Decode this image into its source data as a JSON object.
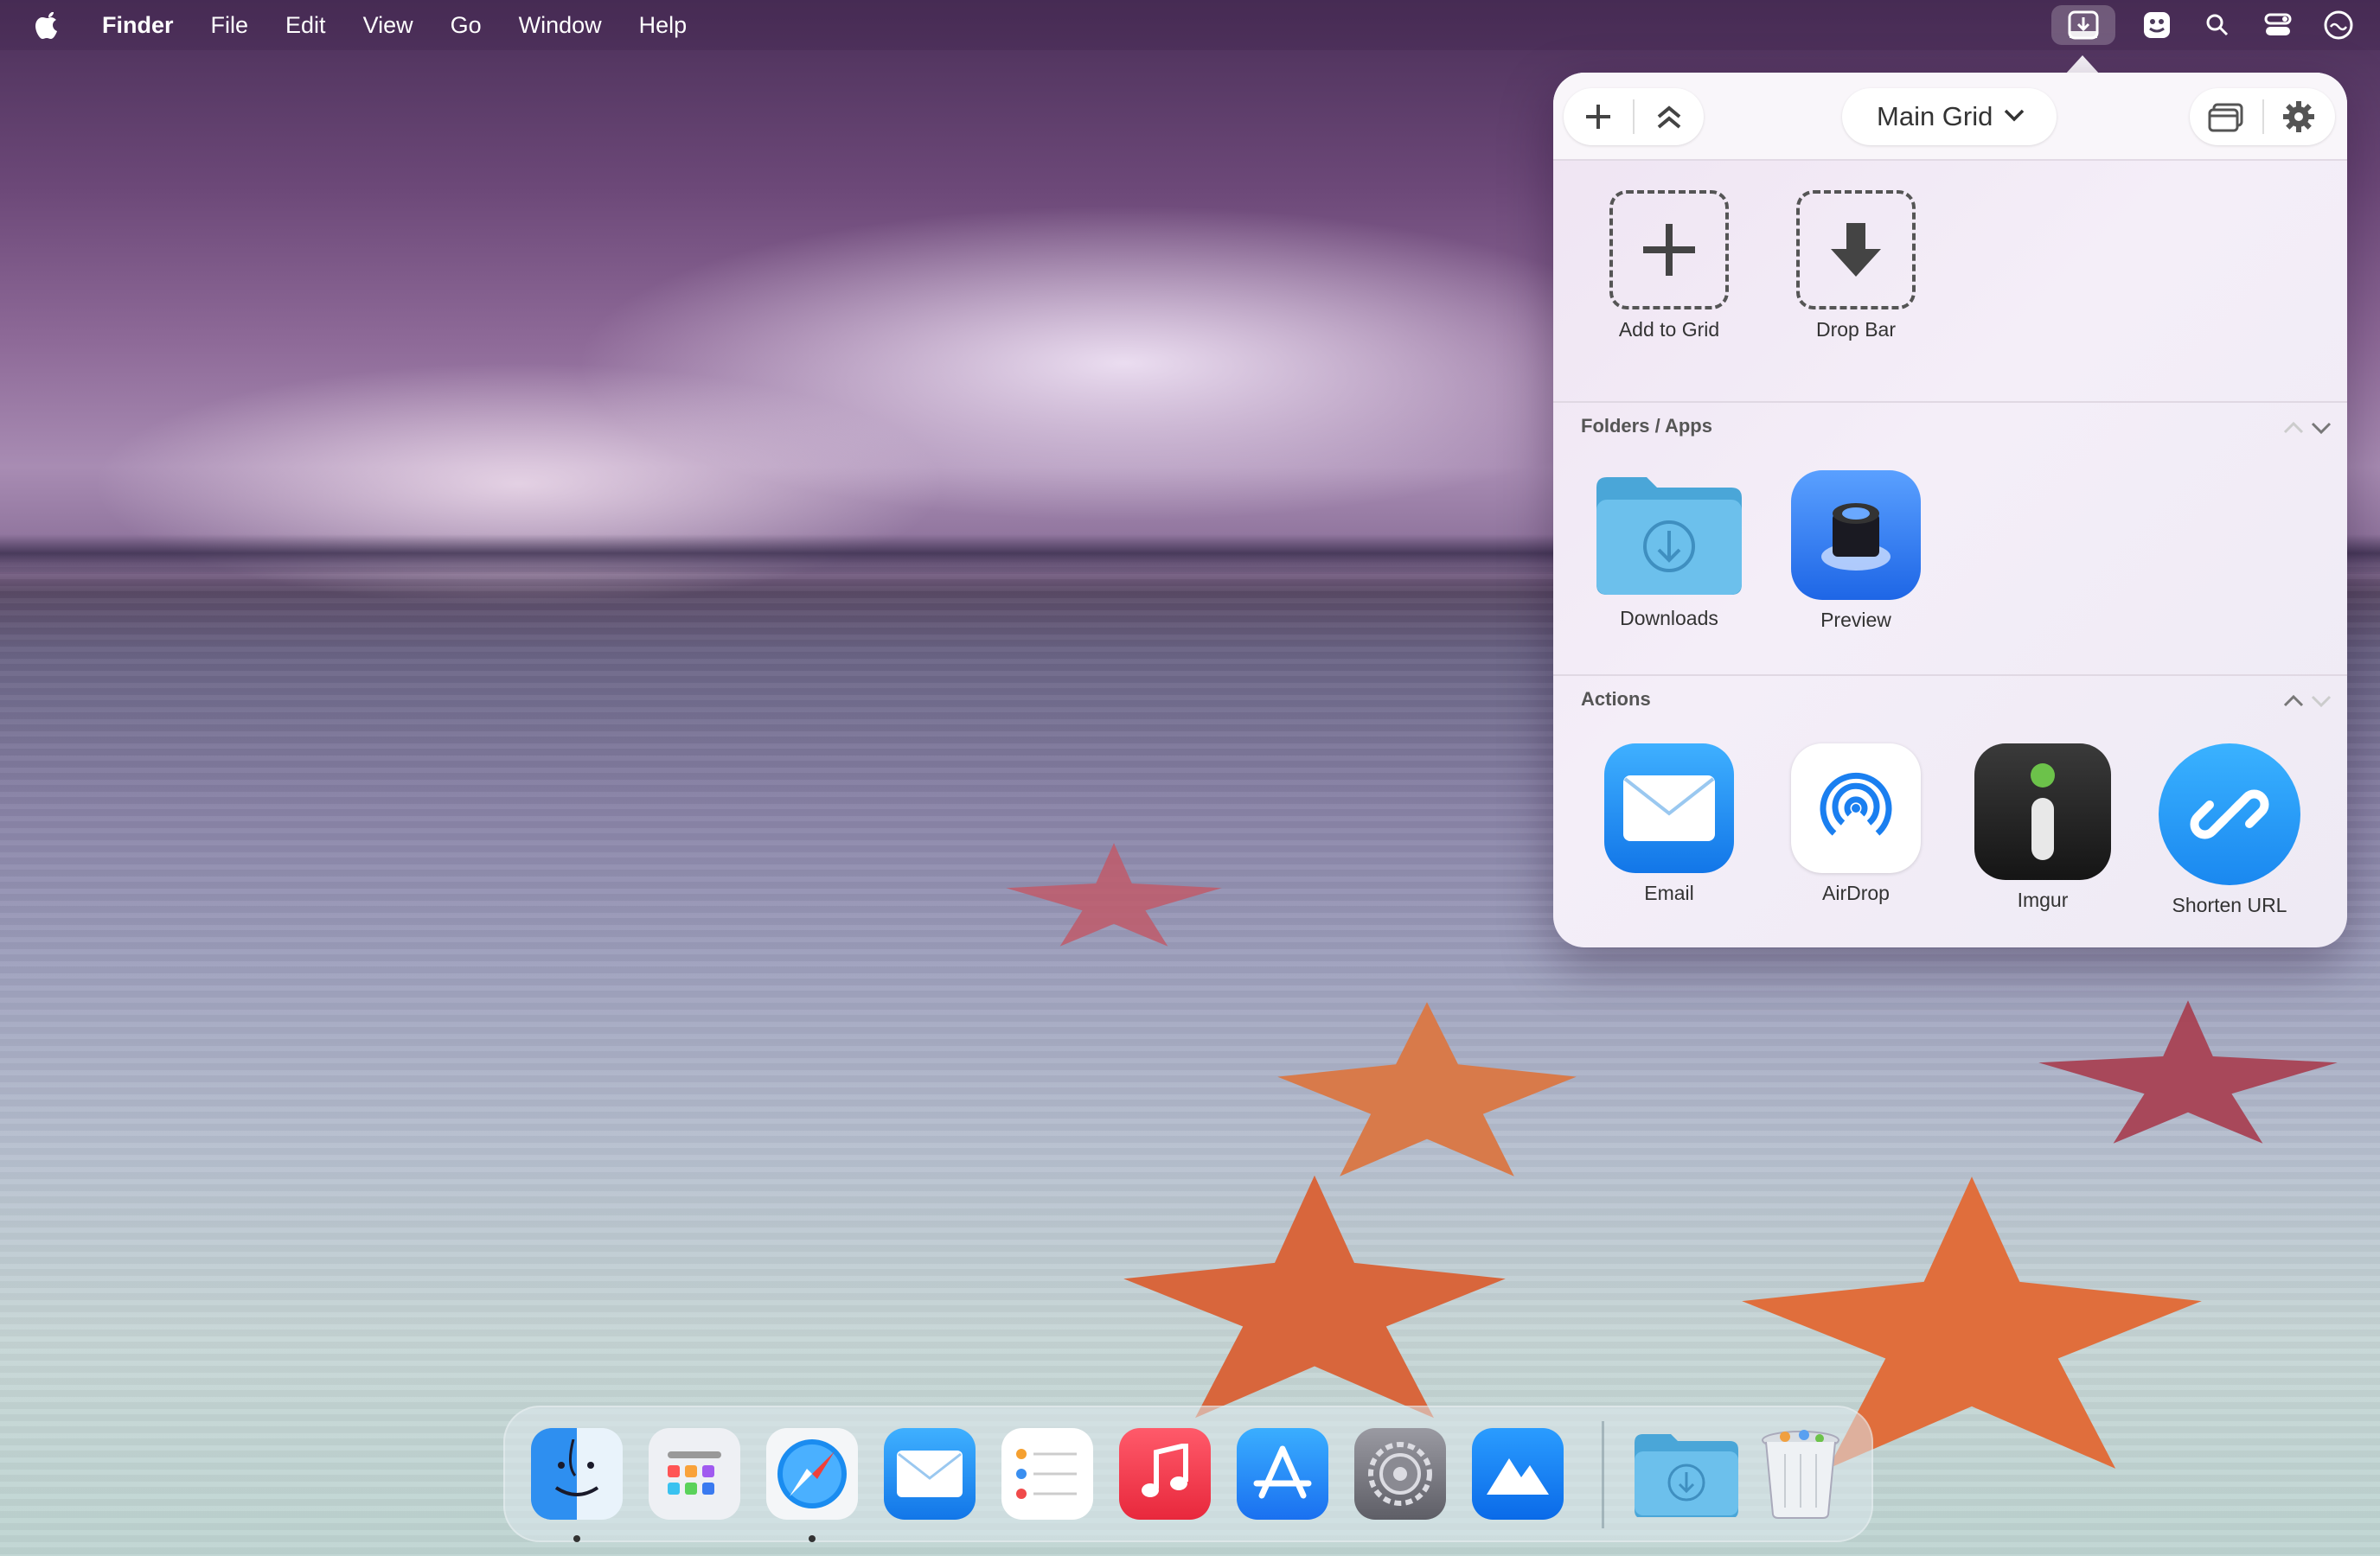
{
  "menubar": {
    "app_name": "Finder",
    "items": [
      "File",
      "Edit",
      "View",
      "Go",
      "Window",
      "Help"
    ],
    "status_icons": [
      "dropzone-icon",
      "tray-icon",
      "search-icon",
      "control-center-icon",
      "siri-icon"
    ]
  },
  "panel": {
    "grid_selector": "Main Grid",
    "toolbar_icons": [
      "plus-icon",
      "collapse-all-icon",
      "windows-icon",
      "gear-icon"
    ],
    "top_tiles": [
      {
        "label": "Add to Grid",
        "icon": "add-icon"
      },
      {
        "label": "Drop Bar",
        "icon": "download-arrow-icon"
      }
    ],
    "folders_section": {
      "title": "Folders / Apps",
      "items": [
        {
          "label": "Downloads",
          "icon": "downloads-folder-icon"
        },
        {
          "label": "Preview",
          "icon": "preview-app-icon"
        }
      ]
    },
    "actions_section": {
      "title": "Actions",
      "items": [
        {
          "label": "Email",
          "icon": "mail-icon"
        },
        {
          "label": "AirDrop",
          "icon": "airdrop-icon"
        },
        {
          "label": "Imgur",
          "icon": "imgur-icon"
        },
        {
          "label": "Shorten URL",
          "icon": "link-icon"
        }
      ]
    }
  },
  "dock": {
    "apps": [
      "finder-icon",
      "launchpad-icon",
      "safari-icon",
      "mail-icon",
      "reminders-icon",
      "music-icon",
      "app-store-icon",
      "system-settings-icon",
      "altitude-icon",
      "downloads-folder-icon",
      "trash-icon"
    ]
  },
  "colors": {
    "accent_blue": "#1e8cf0",
    "folder_blue": "#5ab8ea",
    "music_red": "#f0384a"
  }
}
